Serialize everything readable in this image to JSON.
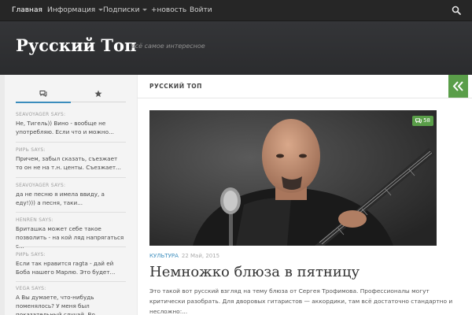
{
  "nav": {
    "items": [
      {
        "label": "Главная"
      },
      {
        "label": "Информация"
      },
      {
        "label": "Подписки"
      },
      {
        "label": "+новость"
      },
      {
        "label": "Войти"
      }
    ]
  },
  "header": {
    "title": "Русский Топ",
    "tagline": "всё самое интересное"
  },
  "sidebar": {
    "tabs": [
      {
        "icon": "comments-icon"
      },
      {
        "icon": "star-icon"
      }
    ],
    "comments": [
      {
        "author": "SEAVOYAGER SAYS:",
        "text": "Не, Тигель)) Вино - вообще не употребляю. Если что и можно..."
      },
      {
        "author": "РИРЬ SAYS:",
        "text": "Причем, забыл сказать, съезжает то он не на т.н. центы. Съезжает..."
      },
      {
        "author": "SEAVOYAGER SAYS:",
        "text": "да не песню я имела ввиду, а еду!))) а песня, таки..."
      },
      {
        "author": "HENREN SAYS:",
        "text": "Бриташка может себе такое позволить - на кой ляд напрягаться с..."
      },
      {
        "author": "РИРЬ SAYS:",
        "text": "Если так нравится ragta - дай ей Боба нашего Марлю. Это будет..."
      },
      {
        "author": "VEGA SAYS:",
        "text": "А Вы думаете, что-нибудь поменялось? У меня был показательный случай. Во..."
      }
    ]
  },
  "main": {
    "section_title": "РУССКИЙ ТОП",
    "post": {
      "comment_count": "58",
      "category": "Культура",
      "date": "22 Май, 2015",
      "title": "Немножко блюза в пятницу",
      "excerpt": "Это такой вот русский взгляд на тему блюза от Сергея Трофимова. Профессионалы могут критически разобрать. Для дворовых гитаристов — аккордики, там всё достаточно стандартно и несложно:..."
    }
  },
  "colors": {
    "accent": "#3b8dbd",
    "green": "#5a9e49",
    "nav_bg": "#262626",
    "header_bg": "#2f3032"
  }
}
